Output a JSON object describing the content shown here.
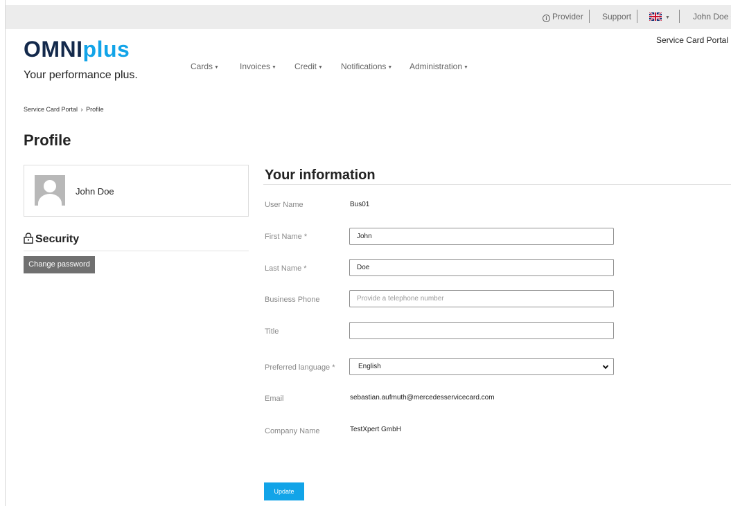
{
  "topbar": {
    "provider_label": "Provider",
    "support_label": "Support",
    "language_icon": "uk-flag-icon",
    "user_menu_label": "John Doe"
  },
  "portal_name": "Service Card Portal",
  "logo": {
    "omni": "OMNI",
    "plus": "plus"
  },
  "tagline": "Your performance plus.",
  "nav": [
    {
      "label": "Cards"
    },
    {
      "label": "Invoices"
    },
    {
      "label": "Credit"
    },
    {
      "label": "Notifications"
    },
    {
      "label": "Administration"
    }
  ],
  "breadcrumb": {
    "root": "Service Card Portal",
    "separator": "›",
    "current": "Profile"
  },
  "page_title": "Profile",
  "profile_card": {
    "name": "John Doe"
  },
  "security": {
    "title": "Security",
    "change_password_label": "Change password"
  },
  "form": {
    "title": "Your information",
    "user_name_label": "User Name",
    "user_name_value": "Bus01",
    "first_name_label": "First Name *",
    "first_name_value": "John",
    "last_name_label": "Last Name *",
    "last_name_value": "Doe",
    "phone_label": "Business Phone",
    "phone_placeholder": "Provide a telephone number",
    "phone_value": "",
    "title_label": "Title",
    "title_value": "",
    "language_label": "Preferred language *",
    "language_value": "English",
    "email_label": "Email",
    "email_value": "sebastian.aufmuth@mercedesservicecard.com",
    "company_label": "Company Name",
    "company_value": "TestXpert GmbH",
    "update_label": "Update"
  },
  "colors": {
    "brand_dark": "#13294b",
    "brand_blue": "#12a4e8",
    "topbar_bg": "#ececec",
    "button_gray": "#707070"
  }
}
